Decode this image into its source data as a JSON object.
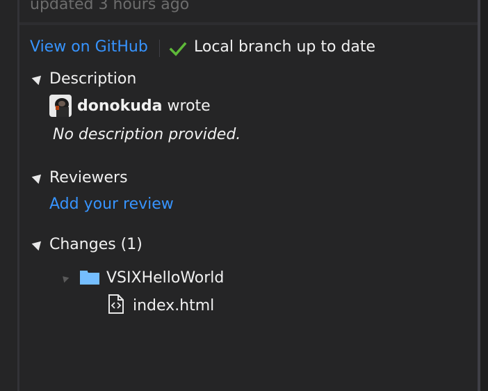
{
  "header": {
    "updated_text": "updated 3 hours ago"
  },
  "status_bar": {
    "view_on_github": "View on GitHub",
    "branch_status": "Local branch up to date"
  },
  "description": {
    "title": "Description",
    "author": "donokuda",
    "wrote": "wrote",
    "body": "No description provided."
  },
  "reviewers": {
    "title": "Reviewers",
    "add_review": "Add your review"
  },
  "changes": {
    "title": "Changes (1)",
    "tree": {
      "folder": "VSIXHelloWorld",
      "files": [
        "index.html"
      ]
    }
  },
  "colors": {
    "background": "#252526",
    "link": "#3794ff",
    "check": "#5eb939",
    "folder": "#75beff",
    "text": "#f1f1f1"
  },
  "icons": {
    "status": "check-icon",
    "folder": "folder-icon",
    "file": "html-file-icon"
  }
}
